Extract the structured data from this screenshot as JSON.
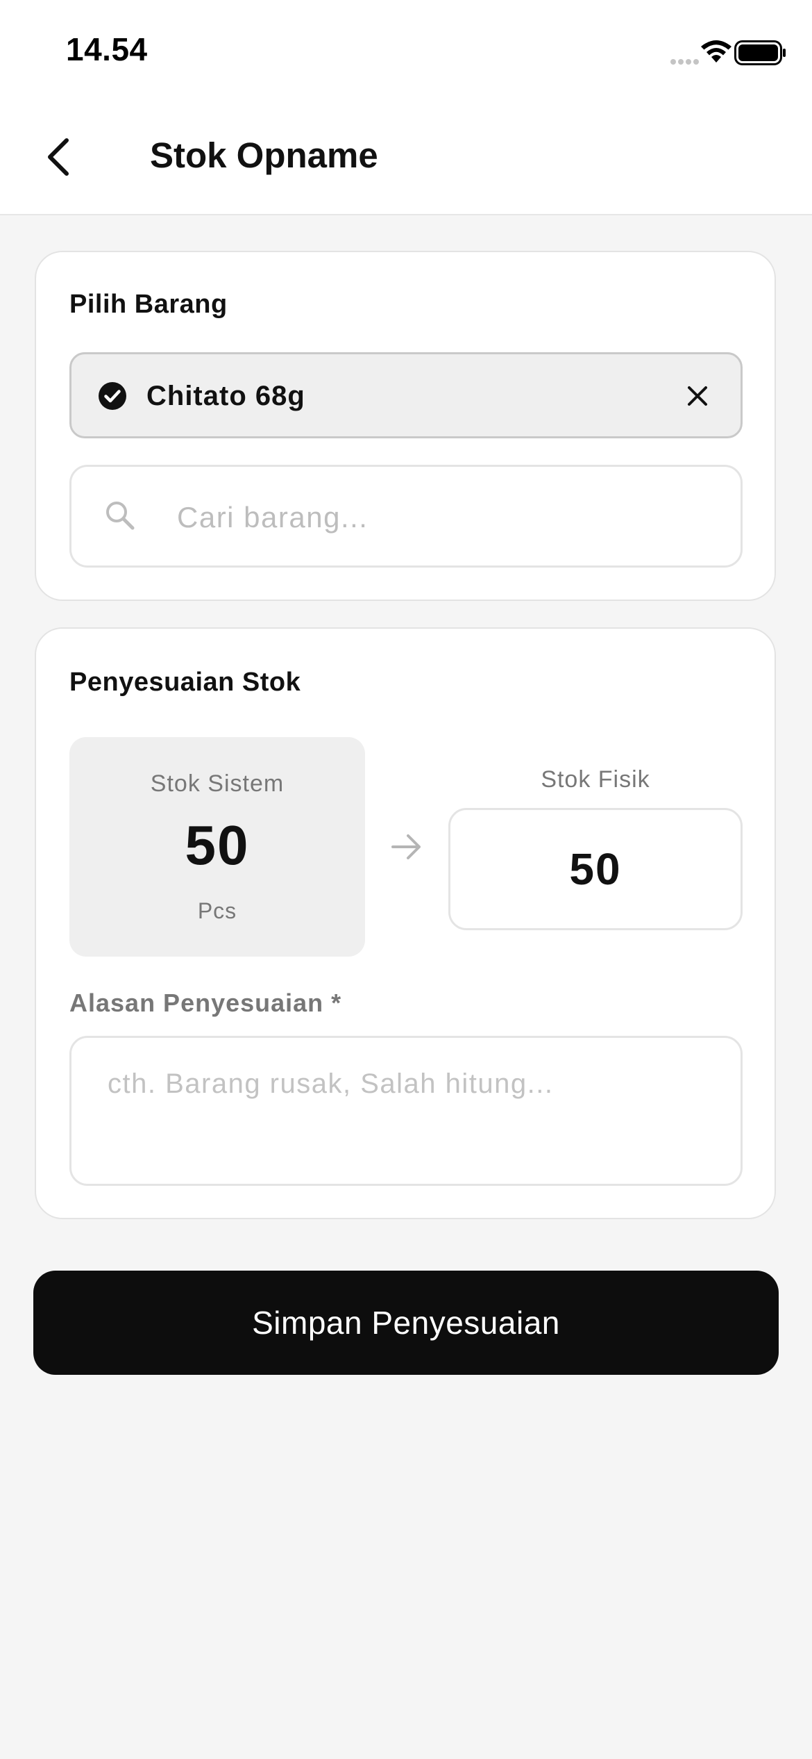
{
  "status_bar": {
    "time": "14.54"
  },
  "header": {
    "title": "Stok Opname",
    "back_icon": "chevron-left-icon"
  },
  "item_picker": {
    "section_title": "Pilih Barang",
    "selected_item": "Chitato 68g",
    "search_placeholder": "Cari barang...",
    "search_value": ""
  },
  "adjustment": {
    "section_title": "Penyesuaian Stok",
    "system_stock_label": "Stok Sistem",
    "system_stock_value": "50",
    "system_stock_unit": "Pcs",
    "physical_stock_label": "Stok Fisik",
    "physical_stock_value": "50",
    "reason_label": "Alasan Penyesuaian *",
    "reason_placeholder": "cth. Barang rusak, Salah hitung...",
    "reason_value": ""
  },
  "actions": {
    "save_label": "Simpan Penyesuaian"
  },
  "colors": {
    "background": "#f5f5f5",
    "primary_button": "#0d0d0d",
    "muted_text": "#777777",
    "border": "#e4e4e4"
  }
}
